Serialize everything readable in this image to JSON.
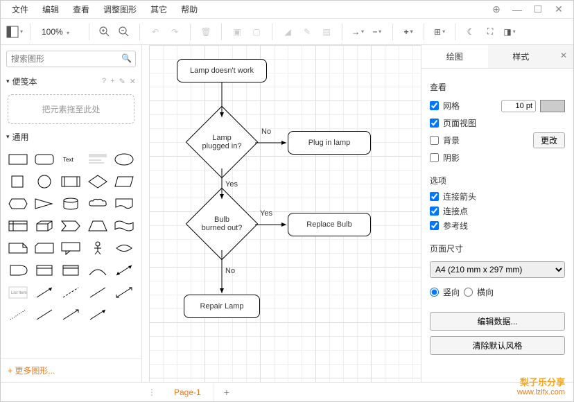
{
  "menu": {
    "items": [
      "文件",
      "编辑",
      "查看",
      "调整图形",
      "其它",
      "帮助"
    ]
  },
  "toolbar": {
    "zoom": "100%"
  },
  "search": {
    "placeholder": "搜索图形"
  },
  "scratchpad": {
    "title": "便笺本",
    "hint": "?",
    "drop_text": "把元素拖至此处"
  },
  "shapes_section": {
    "title": "通用"
  },
  "more_shapes": "+ 更多图形...",
  "flowchart": {
    "start": "Lamp doesn't work",
    "d1": "Lamp\nplugged in?",
    "a1": "Plug in lamp",
    "d2": "Bulb\nburned out?",
    "a2": "Replace Bulb",
    "end": "Repair Lamp",
    "no": "No",
    "yes": "Yes"
  },
  "right": {
    "tab_diagram": "绘图",
    "tab_style": "样式",
    "view_title": "查看",
    "grid": "网格",
    "grid_pt": "10 pt",
    "page_view": "页面视图",
    "background": "背景",
    "change": "更改",
    "shadow": "阴影",
    "options_title": "选项",
    "conn_arrows": "连接箭头",
    "conn_points": "连接点",
    "guides": "参考线",
    "page_size_title": "页面尺寸",
    "page_size": "A4 (210 mm x 297 mm)",
    "portrait": "竖向",
    "landscape": "横向",
    "edit_data": "编辑数据...",
    "clear_default": "清除默认风格"
  },
  "footer": {
    "page": "Page-1"
  },
  "watermark": {
    "l1": "梨子乐分享",
    "l2": "www.lzlfx.com"
  }
}
